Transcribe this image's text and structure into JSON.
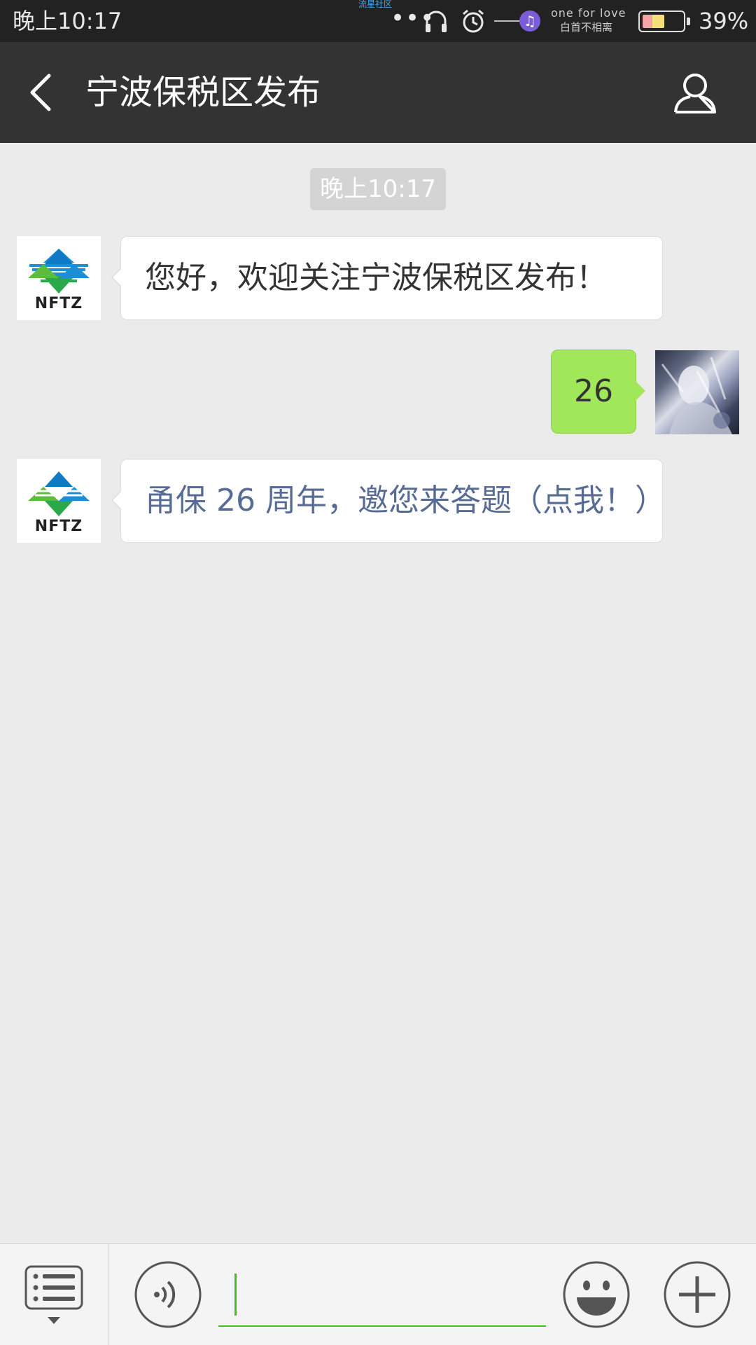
{
  "status_bar": {
    "time": "晚上10:17",
    "meteor_label": "流星社区",
    "dots": "•••",
    "song_line1": "one for love",
    "song_line2": "白首不相离",
    "note_glyph": "♫",
    "battery_percent": "39%",
    "battery_level": 0.39,
    "icons": [
      "headphones-icon",
      "alarm-icon",
      "music-note-icon",
      "battery-icon"
    ]
  },
  "header": {
    "title": "宁波保税区发布",
    "back_icon": "chevron-left-icon",
    "profile_icon": "person-icon",
    "background": "#333333"
  },
  "chat": {
    "timestamp": "晚上10:17",
    "messages": [
      {
        "from": "official",
        "avatar_text": "NFTZ",
        "text": "您好，欢迎关注宁波保税区发布！",
        "is_link": false
      },
      {
        "from": "me",
        "text": "26",
        "is_link": false
      },
      {
        "from": "official",
        "avatar_text": "NFTZ",
        "text": "甬保 26 周年，邀您来答题（点我！）",
        "is_link": true
      }
    ]
  },
  "bottom_bar": {
    "menu_icon": "list-menu-icon",
    "voice_icon": "voice-icon",
    "emoji_icon": "emoji-icon",
    "plus_icon": "plus-icon",
    "input_value": "",
    "accent": "#45c01a"
  },
  "colors": {
    "bubble_me": "#a0e75a",
    "bubble_other": "#ffffff",
    "link": "#576b95",
    "chat_bg": "#ebebeb"
  }
}
